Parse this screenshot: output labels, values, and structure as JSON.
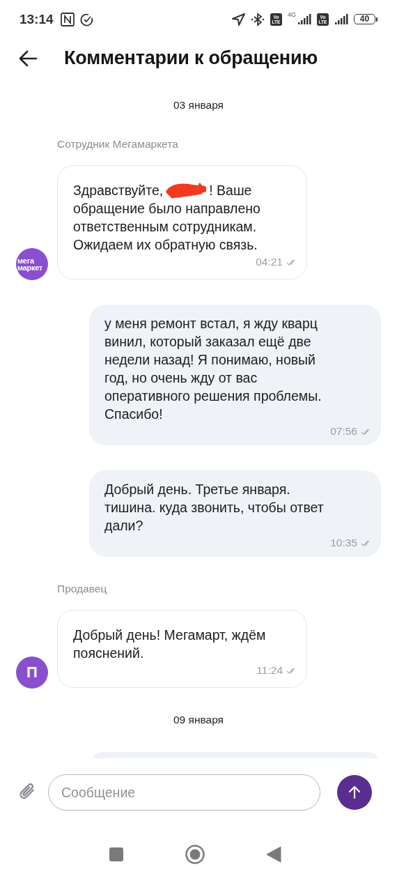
{
  "status_bar": {
    "time": "13:14",
    "network": "4G",
    "volte_badges": [
      "Vo LTE",
      "Vo LTE"
    ],
    "battery": "40"
  },
  "header": {
    "title": "Комментарии к обращению"
  },
  "feed": [
    {
      "kind": "date",
      "text": "03 января"
    },
    {
      "kind": "sender",
      "text": "Сотрудник Мегамаркета"
    },
    {
      "kind": "incoming",
      "avatar": {
        "kind": "logo",
        "text": "мега маркет"
      },
      "text_parts": [
        "Здравствуйте,",
        "! Ваше",
        "обращение было направлено\nответственным сотрудникам.\nОжидаем их обратную связь."
      ],
      "time": "04:21",
      "read": true
    },
    {
      "kind": "outgoing",
      "text_parts": [
        "у меня ремонт встал, я жду кварц\nвинил, который заказал ещё две\nнедели назад! Я понимаю, новый\nгод, но очень жду от вас\nоперативного решения проблемы.\nСпасибо!"
      ],
      "time": "07:56",
      "read": true
    },
    {
      "kind": "outgoing",
      "text_parts": [
        "Добрый день. Третье января.\nтишина. куда звонить, чтобы ответ\nдали?"
      ],
      "time": "10:35",
      "read": true
    },
    {
      "kind": "sender",
      "text": "Продавец"
    },
    {
      "kind": "incoming",
      "avatar": {
        "kind": "letter",
        "text": "П"
      },
      "text_parts": [
        "Добрый день! Мегамарт, ждём\nпояснений."
      ],
      "time": "11:24",
      "read": true
    },
    {
      "kind": "date",
      "text": "09 января"
    },
    {
      "kind": "outgoing"
    }
  ],
  "composer": {
    "placeholder": "Сообщение"
  }
}
